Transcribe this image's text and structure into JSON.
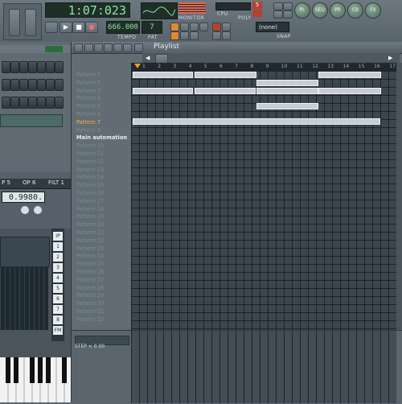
{
  "transport": {
    "time": "1:07:023",
    "tempo_label": "TEMPO",
    "pat_label": "PAT",
    "tempo": "666.000",
    "pattern": "7"
  },
  "monitor": {
    "label": "MONITOR"
  },
  "cpu_poly": {
    "cpu_label": "CPU",
    "poly_label": "POLY",
    "value": "5"
  },
  "snap": {
    "value": "(none)",
    "label": "SNAP"
  },
  "right_buttons": [
    "PL",
    "SEQ",
    "PR",
    "CB",
    "FX"
  ],
  "left_panel": {
    "tabs": [
      "P 5",
      "OP 6",
      "FILT 1"
    ],
    "value_display": "0.9980.",
    "labels": [
      "IP",
      "1",
      "2",
      "3",
      "4",
      "5",
      "6",
      "7",
      "8",
      "FM"
    ]
  },
  "playlist": {
    "title": "Playlist",
    "ruler": [
      "1",
      "2",
      "3",
      "4",
      "5",
      "6",
      "7",
      "8",
      "9",
      "10",
      "11",
      "12",
      "13",
      "14",
      "15",
      "16",
      "17"
    ],
    "patterns": [
      "Pattern 1",
      "Pattern 2",
      "Pattern 3",
      "Pattern 4",
      "Pattern 5",
      "Pattern 6",
      "Pattern 7",
      "Pattern 8",
      "Main automation",
      "Pattern 10",
      "Pattern 11",
      "Pattern 12",
      "Pattern 13",
      "Pattern 14",
      "Pattern 15",
      "Pattern 16",
      "Pattern 17",
      "Pattern 18",
      "Pattern 19",
      "Pattern 20",
      "Pattern 21",
      "Pattern 22",
      "Pattern 23",
      "Pattern 24",
      "Pattern 25",
      "Pattern 26",
      "Pattern 27",
      "Pattern 28",
      "Pattern 29",
      "Pattern 30",
      "Pattern 31",
      "Pattern 32"
    ],
    "active_index": 6,
    "bold_index": 8,
    "bottom_label": "STEP × 0.00"
  }
}
